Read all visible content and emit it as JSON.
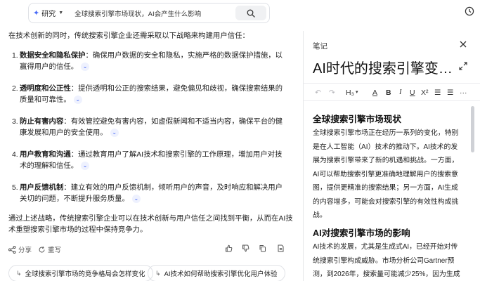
{
  "search": {
    "mode_label": "研究",
    "query": "全球搜索引擎市场现状，AI会产生什么影响"
  },
  "answer": {
    "intro": "在技术创新的同时，传统搜索引擎企业还需采取以下战略来构建用户信任：",
    "items": [
      {
        "num": "1.",
        "title": "数据安全和隐私保护",
        "text": "：确保用户数据的安全和隐私，实施严格的数据保护措施，以赢得用户的信任。"
      },
      {
        "num": "2.",
        "title": "透明度和公正性",
        "text": "：提供透明和公正的搜索结果，避免偏见和歧视，确保搜索结果的质量和可靠性。"
      },
      {
        "num": "3.",
        "title": "防止有害内容",
        "text": "：有效管控避免有害内容，如虚假新闻和不适当内容，确保平台的健康发展和用户的安全使用。"
      },
      {
        "num": "4.",
        "title": "用户教育和沟通",
        "text": "：通过教育用户了解AI技术和搜索引擎的工作原理，增加用户对技术的理解和信任。"
      },
      {
        "num": "5.",
        "title": "用户反馈机制",
        "text": "：建立有效的用户反馈机制，倾听用户的声音，及时响应和解决用户关切的问题，不断提升服务质量。"
      }
    ],
    "summary": "通过上述战略，传统搜索引擎企业可以在技术创新与用户信任之间找到平衡，从而在AI技术重塑搜索引擎市场的过程中保持竞争力。",
    "actions": {
      "share": "分享",
      "regenerate": "重写"
    },
    "suggestions": [
      "全球搜索引擎市场的竞争格局会怎样变化",
      "AI技术如何帮助搜索引擎优化用户体验"
    ]
  },
  "notes": {
    "header": "笔记",
    "title": "AI时代的搜索引擎变革...",
    "toolbar": {
      "heading": "H₃",
      "superscript": "X²"
    },
    "content": {
      "h1": "全球搜索引擎市场现状",
      "p1": "全球搜索引擎市场正在经历一系列的变化，特别是在人工智能（AI）技术的推动下。AI技术的发展为搜索引擎带来了新的机遇和挑战。一方面，AI可以帮助搜索引擎更准确地理解用户的搜索意图，提供更精准的搜索结果；另一方面，AI生成的内容增多，可能会对搜索引擎的有效性构成挑战。",
      "h2": "AI对搜索引擎市场的影响",
      "p2": "AI技术的发展，尤其是生成式AI，已经开始对传统搜索引擎构成威胁。市场分析公司Gartner预测，到2026年，搜索量可能减少25%，因为生成"
    }
  },
  "colors": {
    "accent": "#4a6cf7",
    "border": "#e0e2e6"
  }
}
